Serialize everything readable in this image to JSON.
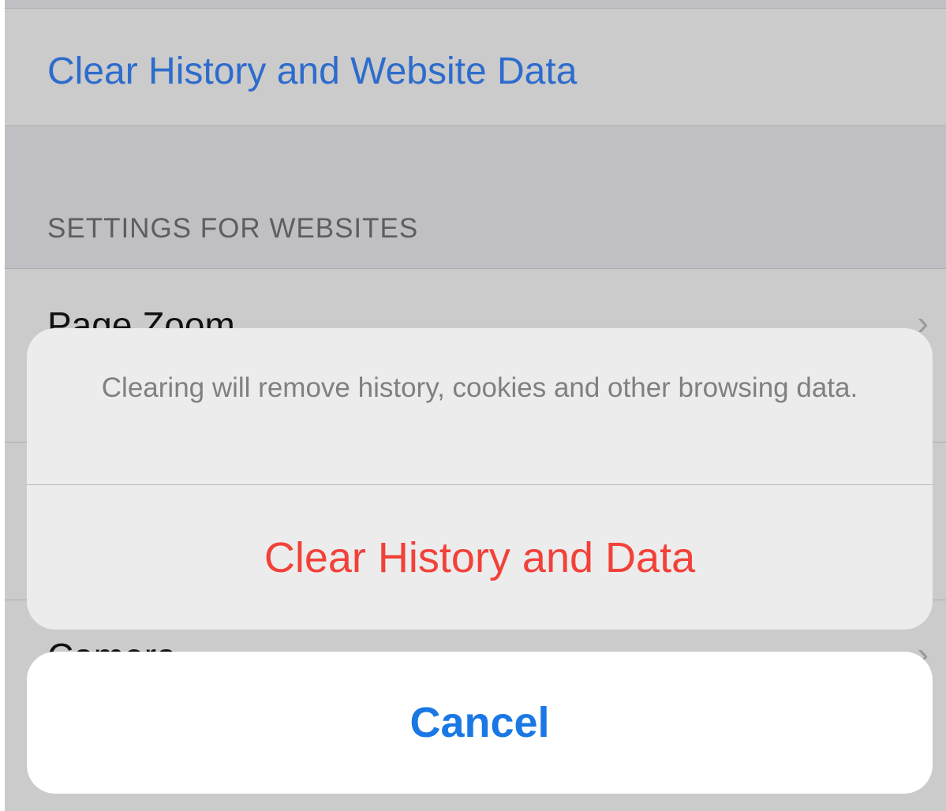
{
  "settings": {
    "clear_row_label": "Clear History and Website Data",
    "section_header": "SETTINGS FOR WEBSITES",
    "page_zoom_label": "Page Zoom",
    "camera_label": "Camera",
    "chevron": "›"
  },
  "action_sheet": {
    "message": "Clearing will remove history, cookies and other browsing data.",
    "destructive_label": "Clear History and Data",
    "cancel_label": "Cancel"
  },
  "colors": {
    "link_blue": "#2d6ccc",
    "destructive_red": "#f24139",
    "cancel_blue": "#1a78e5"
  }
}
